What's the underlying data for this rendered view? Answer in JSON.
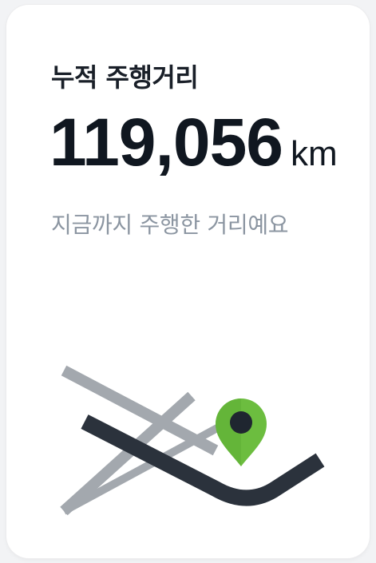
{
  "card": {
    "title": "누적 주행거리",
    "distance_value": "119,056",
    "distance_unit": "km",
    "subtitle": "지금까지 주행한 거리예요"
  },
  "illustration": {
    "icon": "map-pin-icon",
    "pin_color": "#6cbd3f",
    "route_color": "#2b323c",
    "road_color": "#a3a8ae"
  }
}
